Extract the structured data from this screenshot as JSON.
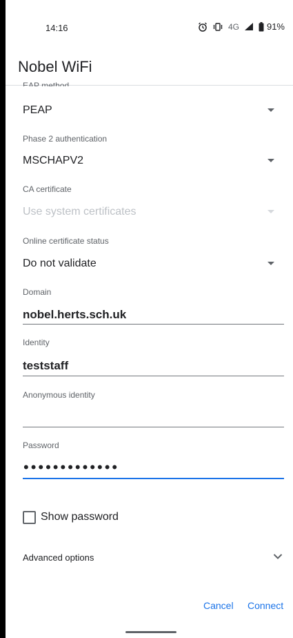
{
  "status_bar": {
    "time": "14:16",
    "network": "4G",
    "battery": "91%",
    "icons": [
      "alarm-icon",
      "vibrate-icon",
      "signal-icon",
      "battery-icon"
    ]
  },
  "dialog": {
    "title": "Nobel WiFi",
    "eap_method": {
      "label": "EAP method",
      "value": "PEAP"
    },
    "phase2": {
      "label": "Phase 2 authentication",
      "value": "MSCHAPV2"
    },
    "ca_certificate": {
      "label": "CA certificate",
      "value": "Use system certificates"
    },
    "online_cert_status": {
      "label": "Online certificate status",
      "value": "Do not validate"
    },
    "domain": {
      "label": "Domain",
      "value": "nobel.herts.sch.uk"
    },
    "identity": {
      "label": "Identity",
      "value": "teststaff"
    },
    "anonymous_identity": {
      "label": "Anonymous identity",
      "value": ""
    },
    "password": {
      "label": "Password",
      "value": "•••••••••••••"
    },
    "show_password": {
      "label": "Show password",
      "checked": false
    },
    "advanced_options": {
      "label": "Advanced options"
    },
    "cancel_label": "Cancel",
    "connect_label": "Connect"
  },
  "colors": {
    "accent": "#1a73e8",
    "text": "#202124",
    "secondary": "#5f6368",
    "disabled": "#bdc1c6"
  }
}
